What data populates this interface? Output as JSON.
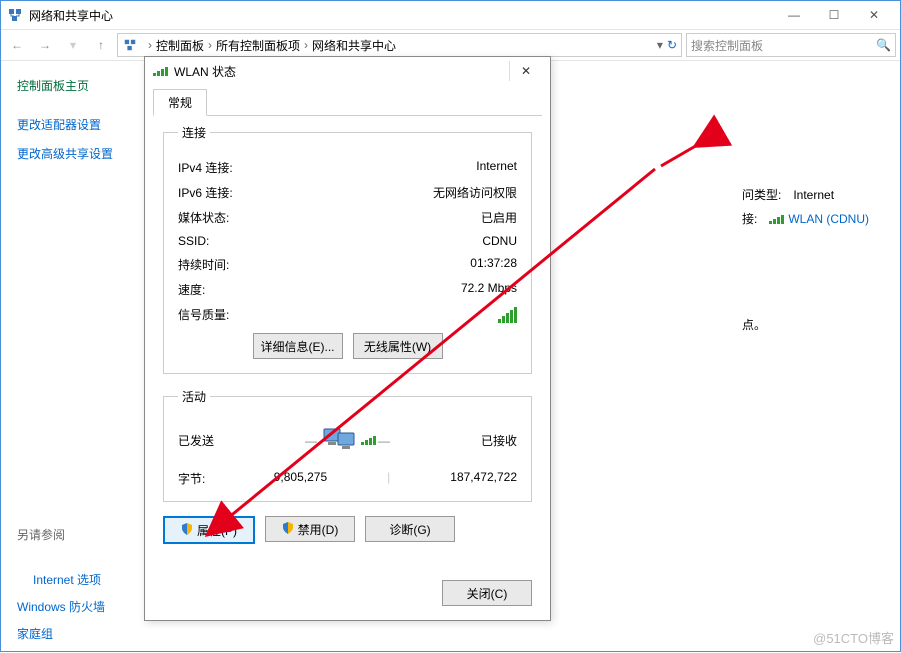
{
  "window": {
    "title": "网络和共享中心",
    "min": "—",
    "max": "☐",
    "close": "✕"
  },
  "nav": {
    "back": "←",
    "fwd": "→",
    "up": "↑"
  },
  "breadcrumb": {
    "items": [
      "控制面板",
      "所有控制面板项",
      "网络和共享中心"
    ],
    "sep": "›",
    "refresh": "↻"
  },
  "search": {
    "placeholder": "搜索控制面板",
    "icon": "🔍"
  },
  "sidebar": {
    "heading": "控制面板主页",
    "links": [
      "更改适配器设置",
      "更改高级共享设置"
    ]
  },
  "right_info": {
    "type_label": "问类型:",
    "type_value": "Internet",
    "conn_label": "接:",
    "conn_value": "WLAN (CDNU)"
  },
  "extra_dot": "点。",
  "see_also": {
    "heading": "另请参阅",
    "links": [
      "Internet 选项",
      "Windows 防火墙",
      "家庭组"
    ]
  },
  "dialog": {
    "title": "WLAN 状态",
    "close": "✕",
    "tab": "常规",
    "connection_legend": "连接",
    "rows": {
      "ipv4_k": "IPv4 连接:",
      "ipv4_v": "Internet",
      "ipv6_k": "IPv6 连接:",
      "ipv6_v": "无网络访问权限",
      "media_k": "媒体状态:",
      "media_v": "已启用",
      "ssid_k": "SSID:",
      "ssid_v": "CDNU",
      "dur_k": "持续时间:",
      "dur_v": "01:37:28",
      "spd_k": "速度:",
      "spd_v": "72.2 Mbps",
      "sig_k": "信号质量:"
    },
    "details_btn": "详细信息(E)...",
    "wireless_btn": "无线属性(W)",
    "activity_legend": "活动",
    "sent": "已发送",
    "recv": "已接收",
    "bytes_label": "字节:",
    "bytes_sent": "9,805,275",
    "bytes_recv": "187,472,722",
    "props_btn": "属性(P)",
    "disable_btn": "禁用(D)",
    "diag_btn": "诊断(G)",
    "close_btn": "关闭(C)"
  },
  "watermark": "@51CTO博客"
}
